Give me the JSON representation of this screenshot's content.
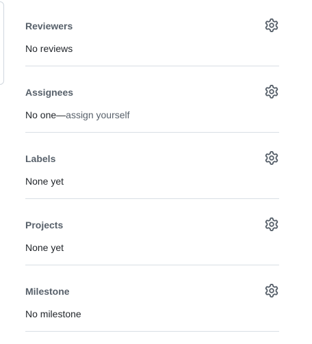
{
  "sidebar": {
    "reviewers": {
      "title": "Reviewers",
      "value": "No reviews",
      "icon": "gear-icon"
    },
    "assignees": {
      "title": "Assignees",
      "value_prefix": "No one—",
      "value_link": "assign yourself",
      "icon": "gear-icon"
    },
    "labels": {
      "title": "Labels",
      "value": "None yet",
      "icon": "gear-icon"
    },
    "projects": {
      "title": "Projects",
      "value": "None yet",
      "icon": "gear-icon"
    },
    "milestone": {
      "title": "Milestone",
      "value": "No milestone",
      "icon": "gear-icon"
    }
  },
  "colors": {
    "title": "#57606a",
    "text": "#1f2328",
    "divider": "#d8dee4",
    "icon": "#57606a"
  }
}
